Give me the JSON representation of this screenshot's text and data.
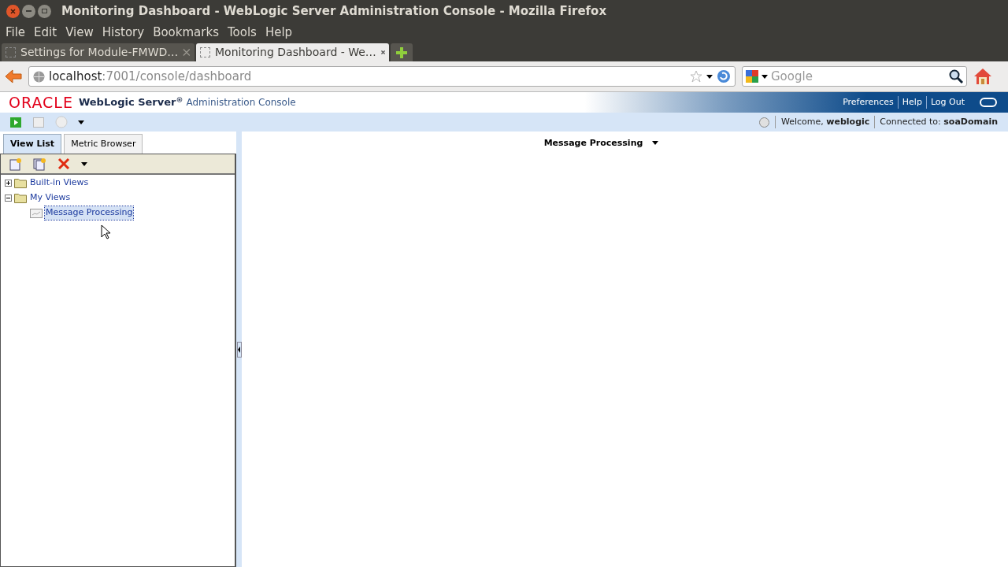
{
  "window": {
    "title": "Monitoring Dashboard - WebLogic Server Administration Console - Mozilla Firefox"
  },
  "menu": [
    "File",
    "Edit",
    "View",
    "History",
    "Bookmarks",
    "Tools",
    "Help"
  ],
  "browser_tabs": [
    {
      "label": "Settings for Module-FMWD…",
      "selected": false
    },
    {
      "label": "Monitoring Dashboard - We…",
      "selected": true
    }
  ],
  "address": {
    "host": "localhost",
    "path": ":7001/console/dashboard"
  },
  "search": {
    "placeholder": "Google"
  },
  "header": {
    "brand": "ORACLE",
    "product": "WebLogic Server",
    "mark": "®",
    "subtitle": "Administration Console",
    "links": [
      "Preferences",
      "Help",
      "Log Out"
    ]
  },
  "status": {
    "welcome": "Welcome, **weblogic**",
    "connected": "Connected to: **soaDomain**"
  },
  "panel_tabs": [
    {
      "label": "View List",
      "selected": true
    },
    {
      "label": "Metric Browser",
      "selected": false
    }
  ],
  "tree": [
    {
      "label": "Built-in Views",
      "kind": "folder",
      "expanded": false
    },
    {
      "label": "My Views",
      "kind": "folder",
      "expanded": true,
      "children": [
        {
          "label": "Message Processing",
          "kind": "view",
          "selected": true
        }
      ]
    }
  ],
  "content": {
    "view_title": "Message Processing"
  }
}
